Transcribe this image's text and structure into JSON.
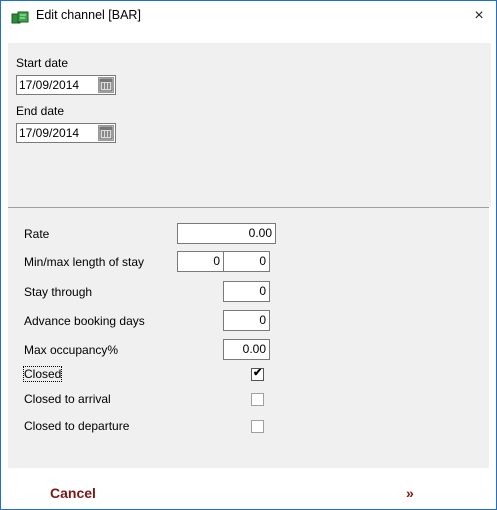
{
  "window": {
    "title": "Edit channel [BAR]",
    "close_glyph": "×"
  },
  "dates": {
    "start_label": "Start date",
    "start_value": "17/09/2014",
    "end_label": "End date",
    "end_value": "17/09/2014"
  },
  "fields": {
    "rate_label": "Rate",
    "rate_value": "0.00",
    "minmax_label": "Min/max length of stay",
    "min_value": "0",
    "max_value": "0",
    "stay_through_label": "Stay through",
    "stay_through_value": "0",
    "advance_booking_label": "Advance booking days",
    "advance_booking_value": "0",
    "max_occupancy_label": "Max occupancy%",
    "max_occupancy_value": "0.00",
    "closed_label": "Closed",
    "closed_checked": true,
    "closed_to_arrival_label": "Closed to arrival",
    "closed_to_arrival_checked": false,
    "closed_to_departure_label": "Closed to departure",
    "closed_to_departure_checked": false
  },
  "footer": {
    "cancel_label": "Cancel",
    "next_label": "»"
  },
  "icons": {
    "app": "channel-icon",
    "calendar": "calendar-icon",
    "close": "close-icon",
    "check": "checkmark-icon"
  },
  "colors": {
    "window_border": "#1f6fd0",
    "action_text": "#7a1818",
    "panel_bg": "#f0f0f0"
  }
}
